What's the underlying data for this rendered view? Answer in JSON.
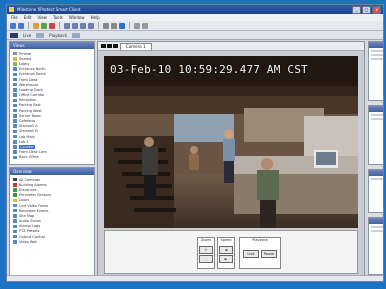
{
  "window": {
    "title": "Milestone XProtect Smart Client",
    "buttons": {
      "minimize": "_",
      "maximize": "□",
      "close": "x"
    }
  },
  "menu": {
    "items": [
      "File",
      "Edit",
      "View",
      "Tools",
      "Window",
      "Help"
    ]
  },
  "toolbar2": {
    "label": "Live",
    "playback": "Playback"
  },
  "left": {
    "views_title": "Views",
    "views": [
      {
        "label": "Private",
        "icon_color": "#7a8fc0"
      },
      {
        "label": "Shared",
        "icon_color": "#e0b24a"
      },
      {
        "label": "Lobby",
        "icon_color": "#7bbf5a"
      },
      {
        "label": "Entrance North",
        "icon_color": "#5b86c9"
      },
      {
        "label": "Entrance South",
        "icon_color": "#5b86c9"
      },
      {
        "label": "Front Desk",
        "icon_color": "#5b86c9"
      },
      {
        "label": "Warehouse",
        "icon_color": "#5b86c9"
      },
      {
        "label": "Loading Dock",
        "icon_color": "#5b86c9"
      },
      {
        "label": "Office Corridor",
        "icon_color": "#5b86c9"
      },
      {
        "label": "Reception",
        "icon_color": "#5b86c9"
      },
      {
        "label": "Parking East",
        "icon_color": "#5b86c9"
      },
      {
        "label": "Parking West",
        "icon_color": "#5b86c9"
      },
      {
        "label": "Server Room",
        "icon_color": "#5b86c9"
      },
      {
        "label": "Cafeteria",
        "icon_color": "#5b86c9"
      },
      {
        "label": "Stairwell A",
        "icon_color": "#5b86c9"
      },
      {
        "label": "Stairwell B",
        "icon_color": "#5b86c9"
      },
      {
        "label": "Lab Main",
        "icon_color": "#5b86c9"
      },
      {
        "label": "Lab 2",
        "icon_color": "#5b86c9"
      },
      {
        "label": "Counter",
        "icon_color": "#5b86c9"
      },
      {
        "label": "Front Desk Cam",
        "icon_color": "#5b86c9"
      },
      {
        "label": "Back Office",
        "icon_color": "#5b86c9"
      }
    ],
    "selected_index": 18,
    "overview_title": "Overview",
    "overview": [
      {
        "label": "All Cameras",
        "icon_color": "#444"
      },
      {
        "label": "Building Alarms",
        "icon_color": "#c33"
      },
      {
        "label": "Entrances",
        "icon_color": "#3a9a3a"
      },
      {
        "label": "Perimeter Sensors",
        "icon_color": "#3a9a3a"
      },
      {
        "label": "Doors",
        "icon_color": "#e0b24a"
      },
      {
        "label": "Live Video Feeds",
        "icon_color": "#5b86c9"
      },
      {
        "label": "Recorded Events",
        "icon_color": "#5b86c9"
      },
      {
        "label": "Site Map",
        "icon_color": "#5b86c9"
      },
      {
        "label": "Audio Zones",
        "icon_color": "#5b86c9"
      },
      {
        "label": "Access Logs",
        "icon_color": "#5b86c9"
      },
      {
        "label": "PTZ Presets",
        "icon_color": "#5b86c9"
      },
      {
        "label": "Output Control",
        "icon_color": "#5b86c9"
      },
      {
        "label": "Video Wall",
        "icon_color": "#5b86c9"
      }
    ]
  },
  "viewer": {
    "tab_label": "Camera 1",
    "timestamp": "03-Feb-10 10:59:29.477 AM CST"
  },
  "controls": {
    "group1_head": "Zoom",
    "group2_head": "Speed",
    "group3_head": "Playback",
    "btn_a": "+",
    "btn_b": "-",
    "btn_c": "◄",
    "btn_d": "►",
    "btn_play": "Live",
    "btn_pause": "Pause"
  }
}
